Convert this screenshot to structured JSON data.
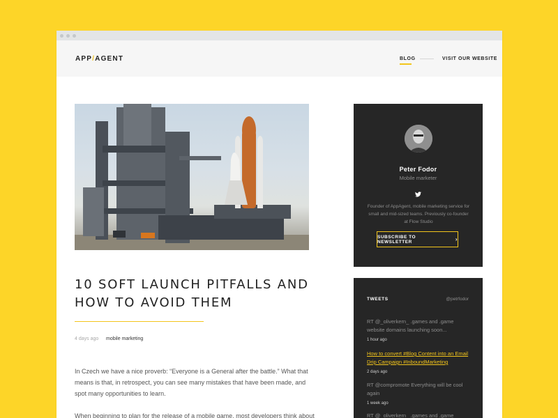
{
  "header": {
    "logo_left": "APP",
    "logo_slash": "/",
    "logo_right": "AGENT",
    "nav": {
      "blog": "BLOG",
      "visit": "VISIT OUR WEBSITE"
    }
  },
  "article": {
    "title": "10 SOFT LAUNCH PITFALLS AND HOW TO AVOID THEM",
    "date": "4 days ago",
    "tag": "mobile marketing",
    "paragraph_1": "In Czech we have a nice proverb: “Everyone is a General after the battle.” What that means is that, in retrospect, you can see many mistakes that have been made, and spot many opportunities to learn.",
    "paragraph_2": "When beginning to plan for the release of a mobile game, most developers think about the"
  },
  "profile": {
    "name": "Peter Fodor",
    "role": "Mobile marketer",
    "bio": "Founder of AppAgent, mobile marketing service for small and mid-sized teams. Previously co-founder at Flow Studio",
    "subscribe_label": "SUBSCRIBE TO NEWSLETTER",
    "subscribe_chevron": "›"
  },
  "tweets": {
    "heading": "TWEETS",
    "handle": "@petrfodor",
    "items": [
      {
        "text": "RT @_oliverkern_ .games and .game website domains launching soon...",
        "time": "1 hour ago"
      },
      {
        "text": "How to convert #Blog Content into an Email Drip Campaign #InboundMarketing",
        "time": "2 days ago"
      },
      {
        "text": "RT @compromote Everything will be cool again",
        "time": "1 week ago"
      },
      {
        "text": "RT @_oliverkern_ .games and .game website",
        "time": ""
      }
    ]
  },
  "colors": {
    "accent": "#f3c51b",
    "background": "#fdd528",
    "card": "#262626"
  }
}
